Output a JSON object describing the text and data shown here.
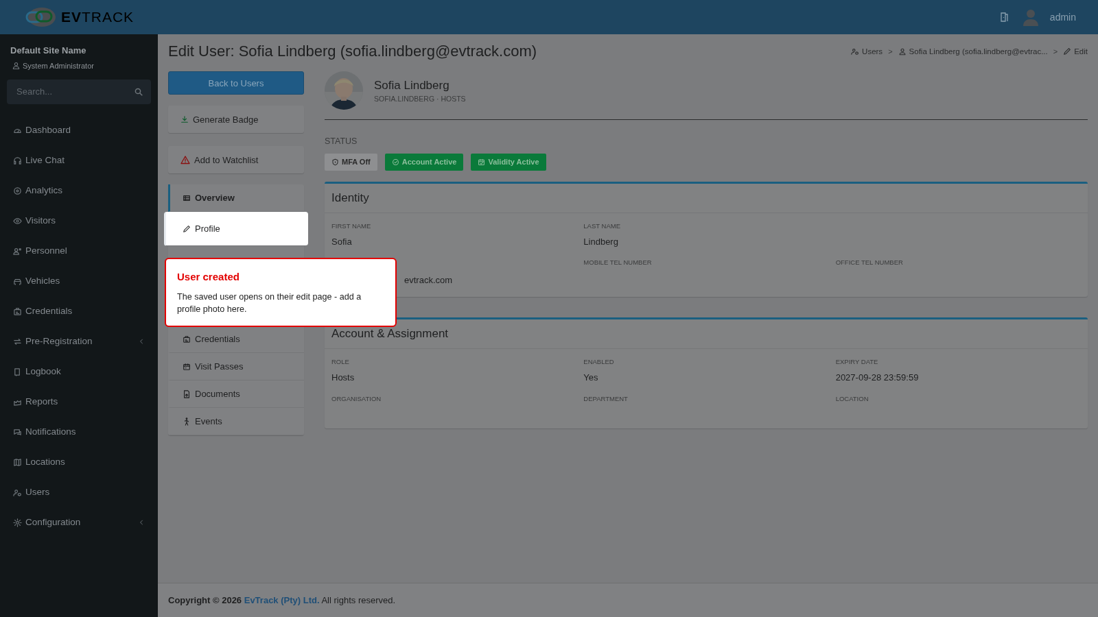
{
  "header": {
    "logo": "**EV**TRACK",
    "user": "admin"
  },
  "sidebar": {
    "site_name": "Default Site Name",
    "role": "System Administrator",
    "search_placeholder": "Search...",
    "items": [
      {
        "label": "Dashboard",
        "expandable": false
      },
      {
        "label": "Live Chat",
        "expandable": false
      },
      {
        "label": "Analytics",
        "expandable": false
      },
      {
        "label": "Visitors",
        "expandable": false
      },
      {
        "label": "Personnel",
        "expandable": false
      },
      {
        "label": "Vehicles",
        "expandable": false
      },
      {
        "label": "Credentials",
        "expandable": false
      },
      {
        "label": "Pre-Registration",
        "expandable": true
      },
      {
        "label": "Logbook",
        "expandable": false
      },
      {
        "label": "Reports",
        "expandable": false
      },
      {
        "label": "Notifications",
        "expandable": false
      },
      {
        "label": "Locations",
        "expandable": false
      },
      {
        "label": "Users",
        "expandable": false
      },
      {
        "label": "Configuration",
        "expandable": true
      }
    ]
  },
  "page": {
    "title": "Edit User: Sofia Lindberg (sofia.lindberg@evtrack.com)",
    "breadcrumb": [
      {
        "label": "Users"
      },
      {
        "separator": ">",
        "label": "Sofia Lindberg (sofia.lindberg@evtrac..."
      },
      {
        "separator": ">",
        "label": "Edit"
      }
    ],
    "back_button": "Back to Users",
    "actions": [
      {
        "label": "Generate Badge",
        "kind": "download"
      },
      {
        "label": "Add to Watchlist",
        "kind": "warning"
      }
    ],
    "tabs": [
      {
        "label": "Overview",
        "selected": true,
        "spotlight": false
      },
      {
        "label": "Profile",
        "selected": false,
        "spotlight": true
      },
      {
        "label": "Credentials",
        "selected": false,
        "spotlight": false
      },
      {
        "label": "Visit Passes",
        "selected": false,
        "spotlight": false
      },
      {
        "label": "Documents",
        "selected": false,
        "spotlight": false
      },
      {
        "label": "Events",
        "selected": false,
        "spotlight": false
      }
    ],
    "profile": {
      "name": "Sofia Lindberg",
      "subtitle": "SOFIA.LINDBERG · HOSTS"
    },
    "status": {
      "heading": "STATUS",
      "badges": [
        {
          "label": "MFA Off",
          "active": false
        },
        {
          "label": "Account Active",
          "active": true
        },
        {
          "label": "Validity Active",
          "active": true
        }
      ]
    },
    "sections": [
      {
        "title": "Identity",
        "rows": [
          [
            {
              "label": "FIRST NAME",
              "value": "Sofia"
            },
            {
              "label": "LAST NAME",
              "value": "Lindberg"
            }
          ],
          [
            {
              "value": "evtrack.com"
            },
            {
              "label": "MOBILE TEL NUMBER"
            },
            {
              "label": "OFFICE TEL NUMBER"
            }
          ]
        ]
      },
      {
        "title": "Account & Assignment",
        "rows": [
          [
            {
              "label": "ROLE",
              "value": "Hosts"
            },
            {
              "label": "ENABLED",
              "value": "Yes"
            },
            {
              "label": "EXPIRY DATE",
              "value": "2027-09-28 23:59:59"
            }
          ],
          [
            {
              "label": "ORGANISATION"
            },
            {
              "label": "DEPARTMENT"
            },
            {
              "label": "LOCATION"
            }
          ]
        ]
      }
    ]
  },
  "callout": {
    "title": "User created",
    "text": "The saved user opens on their edit page - add a profile photo here."
  },
  "footer": {
    "prefix": "Copyright © 2026",
    "link": "EvTrack (Pty) Ltd.",
    "suffix": "All rights reserved."
  }
}
